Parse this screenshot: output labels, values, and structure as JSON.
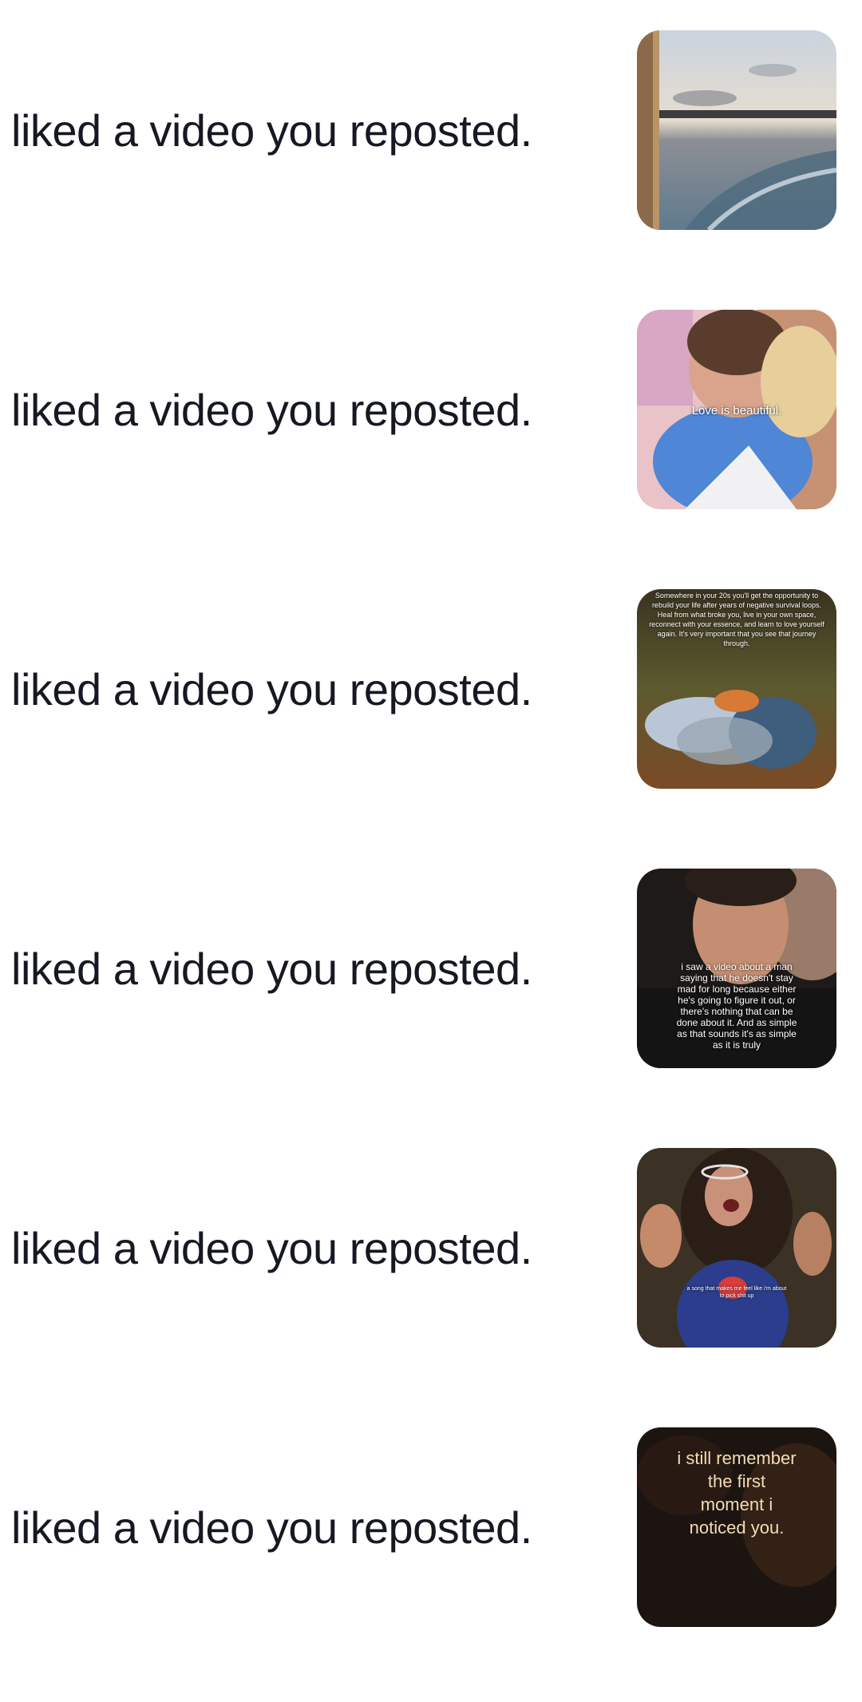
{
  "notifications": [
    {
      "text": "liked a video you reposted.",
      "thumbnail": {
        "subject": "boat wake on a lake at sunset",
        "caption": ""
      }
    },
    {
      "text": "liked a video you reposted.",
      "thumbnail": {
        "subject": "couple embracing",
        "caption": "Love is beautiful."
      }
    },
    {
      "text": "liked a video you reposted.",
      "thumbnail": {
        "subject": "people lying on grass at sunset",
        "caption": "Somewhere in your 20s you'll get the opportunity to rebuild your life after years of negative survival loops. Heal from what broke you, live in your own space, reconnect with your essence, and learn to love yourself again. It's very important that you see that journey through."
      }
    },
    {
      "text": "liked a video you reposted.",
      "thumbnail": {
        "subject": "man lying on a pillow",
        "caption": "i saw a video about a man saying that he doesn't stay mad for long because either he's going to figure it out, or there's nothing that can be done about it. And as simple as that sounds it's as simple as it is truly"
      }
    },
    {
      "text": "liked a video you reposted.",
      "thumbnail": {
        "subject": "woman singing with fists raised",
        "caption": "a song that makes me feel like i'm about to pick shit up"
      }
    },
    {
      "text": "liked a video you reposted.",
      "thumbnail": {
        "subject": "dark portrait",
        "caption": "i still remember the first moment i noticed you."
      }
    }
  ],
  "colors": {
    "text": "#161823",
    "background": "#ffffff"
  }
}
